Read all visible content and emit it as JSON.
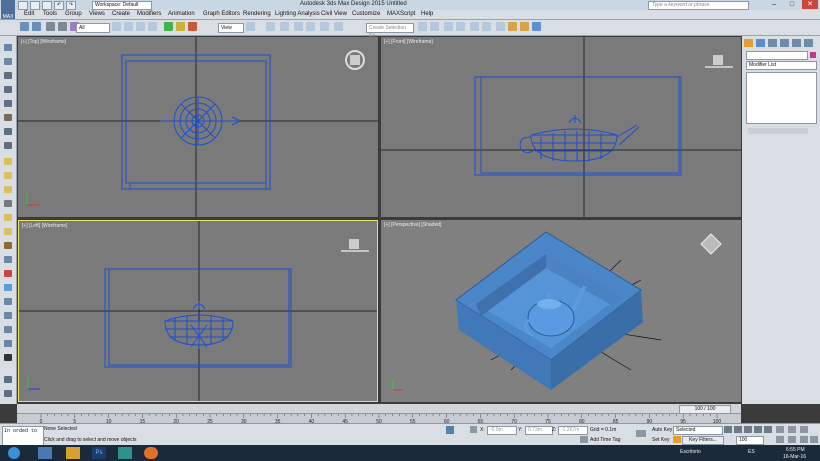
{
  "titlebar": {
    "title": "Autodesk 3ds Max Design 2015      Untitled",
    "workspace": "Workspace: Default",
    "search_placeholder": "Type a keyword or phrase",
    "min": "–",
    "max": "□",
    "close": "✕"
  },
  "menu": [
    "Edit",
    "Tools",
    "Group",
    "Views",
    "Create",
    "Modifiers",
    "Animation",
    "Graph Editors",
    "Rendering",
    "Lighting Analysis",
    "Civil View",
    "Customize",
    "MAXScript",
    "Help"
  ],
  "logo": "MAX",
  "toolbar": {
    "filter_value": "All",
    "view_value": "View",
    "selset_placeholder": "Create Selection Se"
  },
  "viewports": {
    "top": "[+] [Top] [Wireframe]",
    "front": "[+] [Front] [Wireframe]",
    "left": "[+] [Left] [Wireframe]",
    "persp": "[+] [Perspective] [Shaded]"
  },
  "cmdpanel": {
    "modifier_list": "Modifier List"
  },
  "timeline": {
    "slider": "100 / 100",
    "ticks": [
      "0",
      "5",
      "10",
      "15",
      "20",
      "25",
      "30",
      "35",
      "40",
      "45",
      "50",
      "55",
      "60",
      "65",
      "70",
      "75",
      "80",
      "85",
      "90",
      "95",
      "100"
    ]
  },
  "status": {
    "maxscript": "In orded to",
    "selection": "None Selected",
    "prompt": "Click and drag to select and move objects",
    "x_label": "X:",
    "x_value": "-0.0m",
    "y_label": "Y:",
    "y_value": "0.73m",
    "z_label": "Z:",
    "z_value": "-1.267m",
    "grid": "Grid = 0.1m",
    "add_time_tag": "Add Time Tag",
    "auto_key": "Auto Key",
    "auto_key_value": "Selected",
    "set_key": "Set Key",
    "key_filters": "Key Filters...",
    "frame_value": "100"
  },
  "taskbar": {
    "desktop": "Escritorio",
    "lang": "ES",
    "time": "6:55 PM",
    "date": "16-Mar-16"
  },
  "colors": {
    "wire": "#1e4fd0",
    "shaded": "#4a86c8",
    "viewport_bg": "#7a7a7a",
    "active_border": "#e8e060"
  }
}
